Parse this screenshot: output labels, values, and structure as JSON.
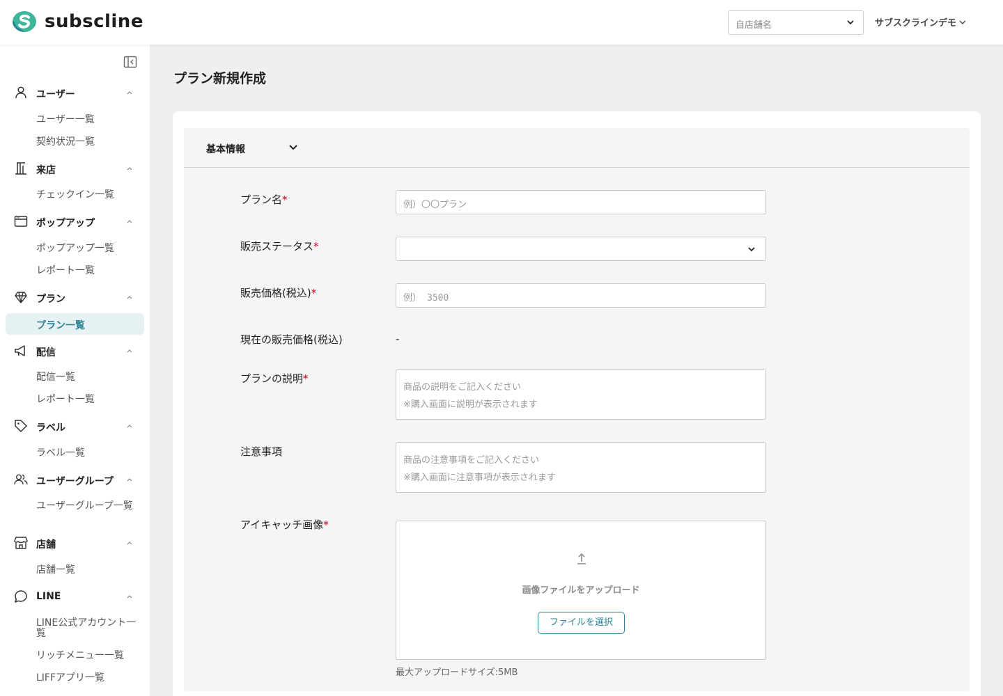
{
  "header": {
    "logo_text": "subscline",
    "store_select_placeholder": "自店舗名",
    "account_name": "サブスクラインデモ"
  },
  "sidebar": {
    "sections": [
      {
        "title": "ユーザー",
        "icon": "user-icon",
        "items": [
          "ユーザー一覧",
          "契約状況一覧"
        ]
      },
      {
        "title": "来店",
        "icon": "building-icon",
        "items": [
          "チェックイン一覧"
        ]
      },
      {
        "title": "ポップアップ",
        "icon": "window-icon",
        "items": [
          "ポップアップ一覧",
          "レポート一覧"
        ]
      },
      {
        "title": "プラン",
        "icon": "diamond-icon",
        "items": [
          "プラン一覧"
        ],
        "active_item": "プラン一覧"
      },
      {
        "title": "配信",
        "icon": "megaphone-icon",
        "items": [
          "配信一覧",
          "レポート一覧"
        ]
      },
      {
        "title": "ラベル",
        "icon": "tag-icon",
        "items": [
          "ラベル一覧"
        ]
      },
      {
        "title": "ユーザーグループ",
        "icon": "users-icon",
        "items": [
          "ユーザーグループ一覧"
        ]
      },
      {
        "title": "店舗",
        "icon": "store-icon",
        "items": [
          "店舗一覧"
        ]
      },
      {
        "title": "LINE",
        "icon": "chat-icon",
        "items": [
          "LINE公式アカウント一覧",
          "リッチメニュー一覧",
          "LIFFアプリ一覧"
        ]
      }
    ]
  },
  "page": {
    "title": "プラン新規作成",
    "section_title": "基本情報"
  },
  "form": {
    "plan_name": {
      "label": "プラン名",
      "placeholder": "例）〇〇プラン",
      "required": "*"
    },
    "sales_status": {
      "label": "販売ステータス",
      "value": "",
      "required": "*"
    },
    "price": {
      "label": "販売価格(税込)",
      "placeholder_prefix": "例）",
      "placeholder_value": "3500",
      "required": "*"
    },
    "current_price": {
      "label": "現在の販売価格(税込)",
      "value": "-"
    },
    "description": {
      "label": "プランの説明",
      "placeholder_line1": "商品の説明をご記入ください",
      "placeholder_line2": "※購入画面に説明が表示されます",
      "required": "*"
    },
    "notes": {
      "label": "注意事項",
      "placeholder_line1": "商品の注意事項をご記入ください",
      "placeholder_line2": "※購入画面に注意事項が表示されます"
    },
    "eyecatch": {
      "label": "アイキャッチ画像",
      "upload_text": "画像ファイルをアップロード",
      "button_label": "ファイルを選択",
      "max_size": "最大アップロードサイズ:5MB",
      "required": "*"
    }
  },
  "colors": {
    "accent": "#2a8496",
    "active_bg": "#e6f1f4",
    "required": "#d0021b",
    "background": "#efefef"
  }
}
